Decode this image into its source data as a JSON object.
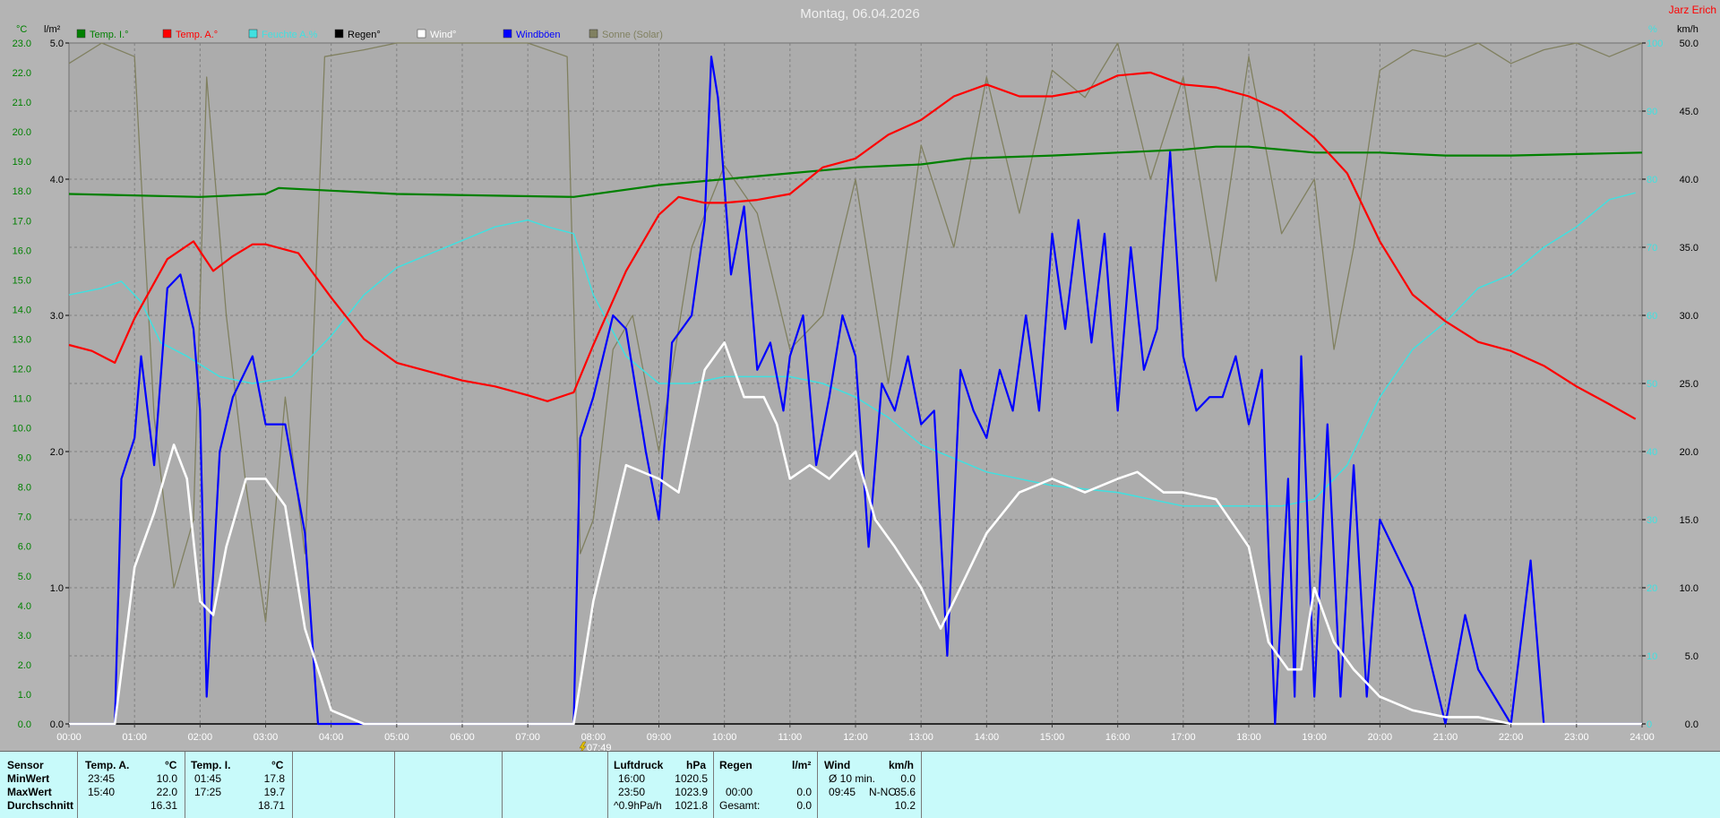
{
  "title": "Montag, 06.04.2026",
  "author": "Jarz Erich",
  "units": {
    "left_temp": "°C",
    "left_rain": "l/m²",
    "right_pct": "%",
    "right_wind": "km/h"
  },
  "marker_label": "07:49",
  "colors": {
    "temp_i": "#008000",
    "temp_a": "#ff0000",
    "humidity": "#40e0e0",
    "rain": "#000000",
    "wind": "#ffffff",
    "gust": "#0000ff",
    "solar": "#808060"
  },
  "chart_data": {
    "type": "line",
    "title": "Montag, 06.04.2026",
    "x_ticks": [
      "00:00",
      "01:00",
      "02:00",
      "03:00",
      "04:00",
      "05:00",
      "06:00",
      "07:00",
      "08:00",
      "09:00",
      "10:00",
      "11:00",
      "12:00",
      "13:00",
      "14:00",
      "15:00",
      "16:00",
      "17:00",
      "18:00",
      "19:00",
      "20:00",
      "21:00",
      "22:00",
      "23:00",
      "24:00"
    ],
    "xlim": [
      0,
      24
    ],
    "y_temp_ticks": [
      "23.0",
      "22.0",
      "21.0",
      "20.0",
      "19.0",
      "18.0",
      "17.0",
      "16.0",
      "15.0",
      "14.0",
      "13.0",
      "12.0",
      "11.0",
      "10.0",
      "9.0",
      "8.0",
      "7.0",
      "6.0",
      "5.0",
      "4.0",
      "3.0",
      "2.0",
      "1.0",
      "0.0"
    ],
    "y_temp_lim": [
      0,
      23
    ],
    "y_rain_ticks": [
      "5.0",
      "4.0",
      "3.0",
      "2.0",
      "1.0",
      "0.0"
    ],
    "y_rain_lim": [
      0,
      5
    ],
    "y_wind_ticks": [
      "50.0",
      "45.0",
      "40.0",
      "35.0",
      "30.0",
      "25.0",
      "20.0",
      "15.0",
      "10.0",
      "5.0",
      "0.0"
    ],
    "y_wind_lim": [
      0,
      50
    ],
    "y_pct_ticks": [
      "100",
      "90",
      "80",
      "70",
      "60",
      "50",
      "40",
      "30",
      "20",
      "10",
      "0"
    ],
    "y_pct_lim": [
      0,
      100
    ],
    "grid": true,
    "legend_position": "top",
    "series": [
      {
        "name": "Temp. I.°",
        "axis": "temp",
        "color": "#008000",
        "x": [
          0,
          2,
          3,
          3.2,
          5,
          7.7,
          9,
          10,
          11,
          12,
          13,
          13.7,
          15,
          16,
          17,
          17.5,
          18,
          18.5,
          19,
          20,
          21,
          22,
          24
        ],
        "y": [
          17.9,
          17.8,
          17.9,
          18.1,
          17.9,
          17.8,
          18.2,
          18.4,
          18.6,
          18.8,
          18.9,
          19.1,
          19.2,
          19.3,
          19.4,
          19.5,
          19.5,
          19.4,
          19.3,
          19.3,
          19.2,
          19.2,
          19.3
        ]
      },
      {
        "name": "Temp. A.°",
        "axis": "temp",
        "color": "#ff0000",
        "x": [
          0,
          0.35,
          0.7,
          1.0,
          1.5,
          1.9,
          2.2,
          2.5,
          2.8,
          3.0,
          3.5,
          4.0,
          4.5,
          5.0,
          5.5,
          6.0,
          6.5,
          7.0,
          7.3,
          7.7,
          8.0,
          8.5,
          9.0,
          9.3,
          9.7,
          10.0,
          10.5,
          11.0,
          11.5,
          12.0,
          12.5,
          13.0,
          13.5,
          14.0,
          14.5,
          15.0,
          15.5,
          16.0,
          16.5,
          17.0,
          17.5,
          18.0,
          18.5,
          19.0,
          19.5,
          20.0,
          20.5,
          21.0,
          21.5,
          22.0,
          22.5,
          23.0,
          23.5,
          23.9
        ],
        "y": [
          12.8,
          12.6,
          12.2,
          13.7,
          15.7,
          16.3,
          15.3,
          15.8,
          16.2,
          16.2,
          15.9,
          14.4,
          13.0,
          12.2,
          11.9,
          11.6,
          11.4,
          11.1,
          10.9,
          11.2,
          12.8,
          15.3,
          17.2,
          17.8,
          17.6,
          17.6,
          17.7,
          17.9,
          18.8,
          19.1,
          19.9,
          20.4,
          21.2,
          21.6,
          21.2,
          21.2,
          21.4,
          21.9,
          22.0,
          21.6,
          21.5,
          21.2,
          20.7,
          19.8,
          18.6,
          16.3,
          14.5,
          13.6,
          12.9,
          12.6,
          12.1,
          11.4,
          10.8,
          10.3
        ]
      },
      {
        "name": "Feuchte A.%",
        "axis": "pct",
        "color": "#40e0e0",
        "x": [
          0,
          0.5,
          0.8,
          1.1,
          1.4,
          1.8,
          2.3,
          2.8,
          3.4,
          4.0,
          4.5,
          5.0,
          5.5,
          6.0,
          6.5,
          7.0,
          7.3,
          7.7,
          8.0,
          8.5,
          9.0,
          9.5,
          10.0,
          10.5,
          11.0,
          11.5,
          12.0,
          12.5,
          13.0,
          13.5,
          14.0,
          15.0,
          16.0,
          17.0,
          18.0,
          18.5,
          19.0,
          19.5,
          20.0,
          20.5,
          21.0,
          21.5,
          22.0,
          22.5,
          23.0,
          23.5,
          23.9
        ],
        "y": [
          63,
          64,
          65,
          62,
          56,
          54,
          51,
          50,
          51,
          57,
          63,
          67,
          69,
          71,
          73,
          74,
          73,
          72,
          63,
          54,
          50,
          50,
          51,
          51,
          51,
          50,
          48,
          45,
          41,
          39,
          37,
          35,
          34,
          32,
          32,
          32,
          33,
          38,
          48,
          55,
          59,
          64,
          66,
          70,
          73,
          77,
          78
        ]
      },
      {
        "name": "Regen°",
        "axis": "rain",
        "color": "#000000",
        "x": [
          0,
          24
        ],
        "y": [
          0,
          0
        ]
      },
      {
        "name": "Wind°",
        "axis": "wind",
        "color": "#ffffff",
        "x": [
          0,
          0.7,
          1.0,
          1.3,
          1.6,
          1.8,
          2.0,
          2.2,
          2.4,
          2.7,
          3.0,
          3.3,
          3.6,
          4.0,
          4.5,
          5.0,
          7.7,
          8.0,
          8.5,
          9.0,
          9.3,
          9.7,
          10.0,
          10.3,
          10.6,
          10.8,
          11.0,
          11.3,
          11.6,
          12.0,
          12.3,
          12.6,
          13.0,
          13.3,
          13.7,
          14.0,
          14.5,
          15.0,
          15.5,
          16.0,
          16.3,
          16.7,
          17.0,
          17.5,
          18.0,
          18.3,
          18.6,
          18.8,
          19.0,
          19.3,
          19.6,
          20.0,
          20.5,
          21.0,
          21.5,
          22.0,
          22.5,
          24
        ],
        "y": [
          0,
          0,
          11.5,
          15.5,
          20.5,
          18,
          9,
          8,
          13,
          18,
          18,
          16,
          7,
          1,
          0,
          0,
          0,
          9,
          19,
          18,
          17,
          26,
          28,
          24,
          24,
          22,
          18,
          19,
          18,
          20,
          15,
          13,
          10,
          7,
          11,
          14,
          17,
          18,
          17,
          18,
          18.5,
          17,
          17,
          16.5,
          13,
          6,
          4,
          4,
          10,
          6,
          4,
          2,
          1,
          0.5,
          0.5,
          0,
          0,
          0
        ]
      },
      {
        "name": "Windböen",
        "axis": "wind",
        "color": "#0000ff",
        "x": [
          0,
          0.7,
          0.8,
          1.0,
          1.1,
          1.3,
          1.5,
          1.7,
          1.9,
          2.0,
          2.1,
          2.3,
          2.5,
          2.8,
          3.0,
          3.3,
          3.6,
          3.8,
          4.0,
          7.7,
          7.8,
          8.0,
          8.3,
          8.5,
          8.8,
          9.0,
          9.2,
          9.5,
          9.7,
          9.8,
          9.9,
          10.1,
          10.3,
          10.5,
          10.7,
          10.9,
          11.0,
          11.2,
          11.4,
          11.6,
          11.8,
          12.0,
          12.2,
          12.4,
          12.6,
          12.8,
          13.0,
          13.2,
          13.4,
          13.6,
          13.8,
          14.0,
          14.2,
          14.4,
          14.6,
          14.8,
          15.0,
          15.2,
          15.4,
          15.6,
          15.8,
          16.0,
          16.2,
          16.4,
          16.6,
          16.8,
          17.0,
          17.2,
          17.4,
          17.6,
          17.8,
          18.0,
          18.2,
          18.4,
          18.6,
          18.7,
          18.8,
          19.0,
          19.2,
          19.4,
          19.6,
          19.8,
          20.0,
          20.5,
          21.0,
          21.3,
          21.5,
          22.0,
          22.3,
          22.5,
          23.0,
          24
        ],
        "y": [
          0,
          0,
          18,
          21,
          27,
          19,
          32,
          33,
          29,
          23,
          2,
          20,
          24,
          27,
          22,
          22,
          14,
          0,
          0,
          0,
          21,
          24,
          30,
          29,
          20,
          15,
          28,
          30,
          37,
          49,
          46,
          33,
          38,
          26,
          28,
          23,
          27,
          30,
          19,
          24,
          30,
          27,
          13,
          25,
          23,
          27,
          22,
          23,
          5,
          26,
          23,
          21,
          26,
          23,
          30,
          23,
          36,
          29,
          37,
          28,
          36,
          23,
          35,
          26,
          29,
          42,
          27,
          23,
          24,
          24,
          27,
          22,
          26,
          0,
          18,
          2,
          27,
          2,
          22,
          2,
          19,
          2,
          15,
          10,
          0,
          8,
          4,
          0,
          12,
          0,
          0,
          0
        ]
      },
      {
        "name": "Sonne (Solar)",
        "axis": "pct",
        "color": "#808060",
        "x": [
          0,
          0.5,
          1.0,
          1.3,
          1.6,
          1.9,
          2.1,
          2.4,
          2.7,
          3.0,
          3.3,
          3.6,
          3.9,
          4.5,
          5.0,
          6.0,
          7.0,
          7.6,
          7.8,
          8.0,
          8.3,
          8.6,
          9.0,
          9.5,
          10.0,
          10.5,
          11.0,
          11.5,
          12.0,
          12.5,
          13.0,
          13.5,
          14.0,
          14.5,
          15.0,
          15.5,
          16.0,
          16.5,
          17.0,
          17.5,
          18.0,
          18.5,
          19.0,
          19.3,
          19.6,
          20.0,
          20.5,
          21.0,
          21.5,
          22.0,
          22.5,
          23.0,
          23.5,
          24
        ],
        "y": [
          97,
          100,
          98,
          45,
          20,
          30,
          95,
          60,
          35,
          15,
          48,
          25,
          98,
          99,
          100,
          100,
          100,
          98,
          25,
          30,
          55,
          60,
          40,
          70,
          82,
          75,
          55,
          60,
          80,
          50,
          85,
          70,
          95,
          75,
          96,
          92,
          100,
          80,
          95,
          65,
          98,
          72,
          80,
          55,
          70,
          96,
          99,
          98,
          100,
          97,
          99,
          100,
          98,
          100
        ]
      }
    ]
  },
  "stats": {
    "sensor_label": "Sensor",
    "row_labels": [
      "MinWert",
      "MaxWert",
      "Durchschnitt"
    ],
    "temp_a": {
      "header": "Temp. A.",
      "unit": "°C",
      "min_time": "23:45",
      "min_value": "10.0",
      "max_time": "15:40",
      "max_value": "22.0",
      "avg": "16.31"
    },
    "temp_i": {
      "header": "Temp. I.",
      "unit": "°C",
      "min_time": "01:45",
      "min_value": "17.8",
      "max_time": "17:25",
      "max_value": "19.7",
      "avg": "18.71"
    },
    "pressure": {
      "header": "Luftdruck",
      "unit": "hPa",
      "min_time": "16:00",
      "min_value": "1020.5",
      "max_time": "23:50",
      "max_value": "1023.9",
      "trend_label": "^0.9hPa/h",
      "avg": "1021.8"
    },
    "rain": {
      "header": "Regen",
      "unit": "l/m²",
      "max_time": "00:00",
      "max_value": "0.0",
      "total_label": "Gesamt:",
      "total_value": "0.0"
    },
    "wind": {
      "header": "Wind",
      "unit": "km/h",
      "avg10_label": "Ø 10 min.",
      "avg10_value": "0.0",
      "max_time": "09:45",
      "max_dir": "N-NO",
      "max_value": "35.6",
      "avg": "10.2"
    }
  }
}
